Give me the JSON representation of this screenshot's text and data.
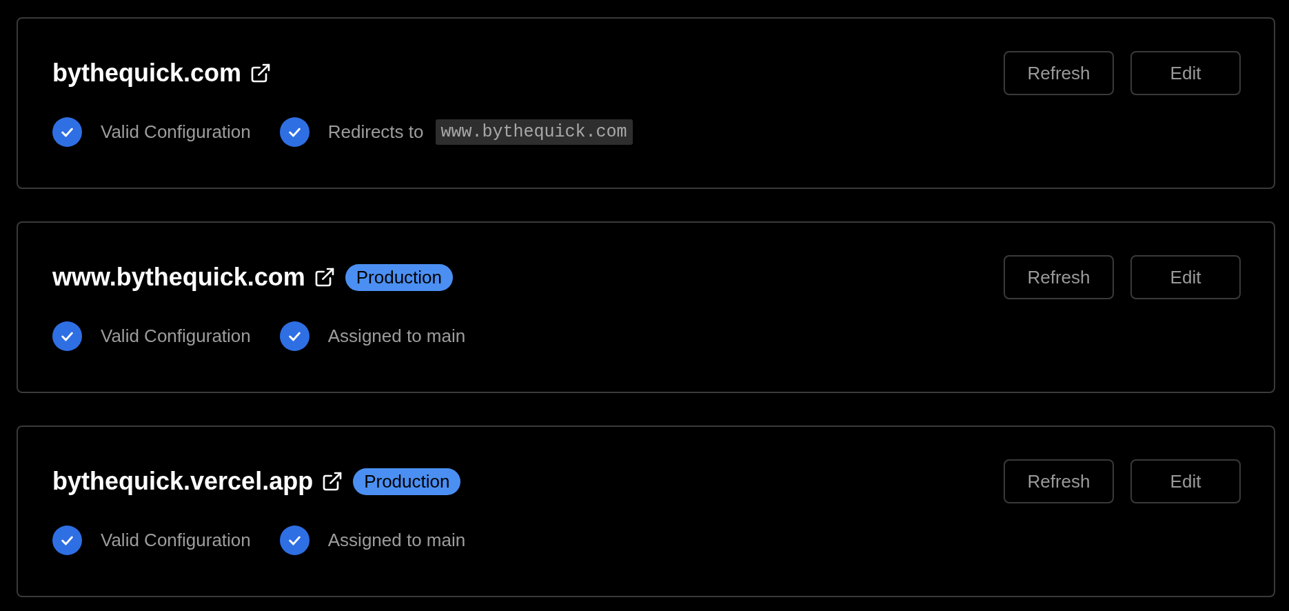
{
  "domains": [
    {
      "name": "bythequick.com",
      "statuses": [
        {
          "text": "Valid Configuration"
        },
        {
          "text": "Redirects to",
          "code": "www.bythequick.com"
        }
      ],
      "buttons": [
        "Refresh",
        "Edit"
      ]
    },
    {
      "name": "www.bythequick.com",
      "badge": "Production",
      "statuses": [
        {
          "text": "Valid Configuration"
        },
        {
          "text": "Assigned to main"
        }
      ],
      "buttons": [
        "Refresh",
        "Edit"
      ]
    },
    {
      "name": "bythequick.vercel.app",
      "badge": "Production",
      "statuses": [
        {
          "text": "Valid Configuration"
        },
        {
          "text": "Assigned to main"
        }
      ],
      "buttons": [
        "Refresh",
        "Edit"
      ]
    }
  ]
}
